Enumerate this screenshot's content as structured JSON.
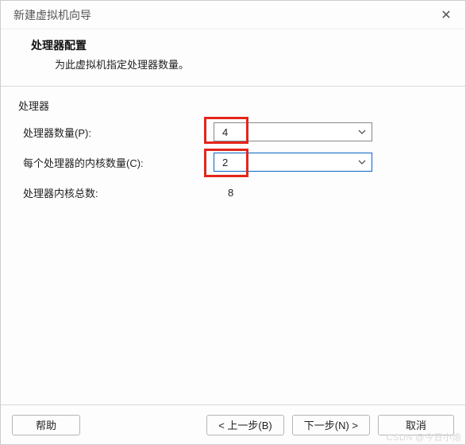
{
  "window": {
    "title": "新建虚拟机向导",
    "close_glyph": "✕"
  },
  "header": {
    "title": "处理器配置",
    "subtitle": "为此虚拟机指定处理器数量。"
  },
  "section": {
    "group_label": "处理器",
    "processor_count_label": "处理器数量(P):",
    "processor_count_value": "4",
    "cores_per_proc_label": "每个处理器的内核数量(C):",
    "cores_per_proc_value": "2",
    "total_cores_label": "处理器内核总数:",
    "total_cores_value": "8"
  },
  "footer": {
    "help": "帮助",
    "back": "< 上一步(B)",
    "next": "下一步(N) >",
    "cancel": "取消"
  },
  "watermark": "CSDN @今日小炮"
}
